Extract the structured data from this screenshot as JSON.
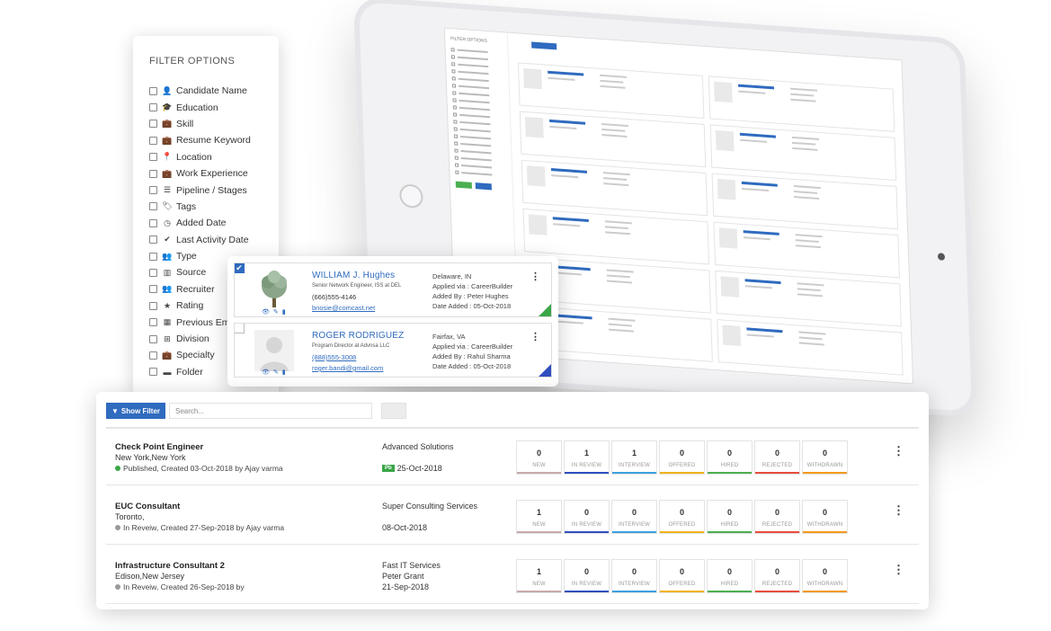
{
  "filter_panel": {
    "title": "FILTER OPTIONS",
    "items": [
      {
        "icon": "user-icon",
        "glyph": "👤",
        "label": "Candidate Name"
      },
      {
        "icon": "graduation-cap-icon",
        "glyph": "🎓",
        "label": "Education"
      },
      {
        "icon": "briefcase-icon",
        "glyph": "💼",
        "label": "Skill"
      },
      {
        "icon": "briefcase-icon",
        "glyph": "💼",
        "label": "Resume Keyword"
      },
      {
        "icon": "map-pin-icon",
        "glyph": "📍",
        "label": "Location"
      },
      {
        "icon": "briefcase-icon",
        "glyph": "💼",
        "label": "Work Experience"
      },
      {
        "icon": "list-icon",
        "glyph": "☰",
        "label": "Pipeline / Stages"
      },
      {
        "icon": "tags-icon",
        "glyph": "🏷",
        "label": "Tags"
      },
      {
        "icon": "clock-icon",
        "glyph": "◷",
        "label": "Added Date"
      },
      {
        "icon": "check-icon",
        "glyph": "✔",
        "label": "Last Activity Date"
      },
      {
        "icon": "users-icon",
        "glyph": "👥",
        "label": "Type"
      },
      {
        "icon": "map-icon",
        "glyph": "▥",
        "label": "Source"
      },
      {
        "icon": "users-icon",
        "glyph": "👥",
        "label": "Recruiter"
      },
      {
        "icon": "star-icon",
        "glyph": "★",
        "label": "Rating"
      },
      {
        "icon": "building-icon",
        "glyph": "▦",
        "label": "Previous Emplo"
      },
      {
        "icon": "sitemap-icon",
        "glyph": "⊞",
        "label": "Division"
      },
      {
        "icon": "briefcase-icon",
        "glyph": "💼",
        "label": "Specialty"
      },
      {
        "icon": "folder-icon",
        "glyph": "▬",
        "label": "Folder"
      }
    ]
  },
  "candidates": [
    {
      "checked": true,
      "name": "WILLIAM J. Hughes",
      "title": "Senior Network Engineer, ISS at DEL",
      "phone": "(666)555-4146",
      "email": "bnosie@comcast.net",
      "location": "Delaware, IN",
      "applied_via": "Applied via : CareerBuilder",
      "added_by": "Added By : Peter Hughes",
      "date_added": "Date Added : 05-Oct-2018",
      "corner_color": "#3aa648"
    },
    {
      "checked": false,
      "name": "ROGER RODRIGUEZ",
      "title": "Program Director at Advnsa LLC",
      "phone": "(888)555-3008",
      "email": "roger.bandi@gmail.com",
      "location": "Fairfax, VA",
      "applied_via": "Applied via : CareerBuilder",
      "added_by": "Added By : Rahul Sharma",
      "date_added": "Date Added : 05-Oct-2018",
      "corner_color": "#2f4fbf"
    }
  ],
  "jobs_toolbar": {
    "show_filter_label": "Show Filter",
    "search_placeholder": "Search..."
  },
  "stage_labels": [
    "NEW",
    "IN REVIEW",
    "INTERVIEW",
    "OFFERED",
    "HIRED",
    "REJECTED",
    "WITHDRAWN"
  ],
  "stage_colors": [
    "#c9a9a9",
    "#2f4fbf",
    "#3ba0e0",
    "#f2b21b",
    "#4caf50",
    "#e84c3d",
    "#f39a1e"
  ],
  "jobs": [
    {
      "title": "Check Point Engineer",
      "location": "New York,New York",
      "status": "Published, Created 03-Oct-2018 by Ajay varma",
      "status_color": "#3aa648",
      "client": "Advanced Solutions",
      "contact": "",
      "date": "25-Oct-2018",
      "badge": "Pb",
      "counts": [
        "0",
        "1",
        "1",
        "0",
        "0",
        "0",
        "0"
      ]
    },
    {
      "title": "EUC Consultant",
      "location": "Toronto,",
      "status": "In Reveiw, Created 27-Sep-2018 by Ajay varma",
      "status_color": "#999999",
      "client": "Super Consulting Services",
      "contact": "",
      "date": "08-Oct-2018",
      "badge": "",
      "counts": [
        "1",
        "0",
        "0",
        "0",
        "0",
        "0",
        "0"
      ]
    },
    {
      "title": "Infrastructure Consultant 2",
      "location": "Edison,New Jersey",
      "status": "In Reveiw, Created 26-Sep-2018 by",
      "status_color": "#999999",
      "client": "Fast IT Services",
      "contact": "Peter Grant",
      "date": "21-Sep-2018",
      "badge": "",
      "counts": [
        "1",
        "0",
        "0",
        "0",
        "0",
        "0",
        "0"
      ]
    }
  ]
}
